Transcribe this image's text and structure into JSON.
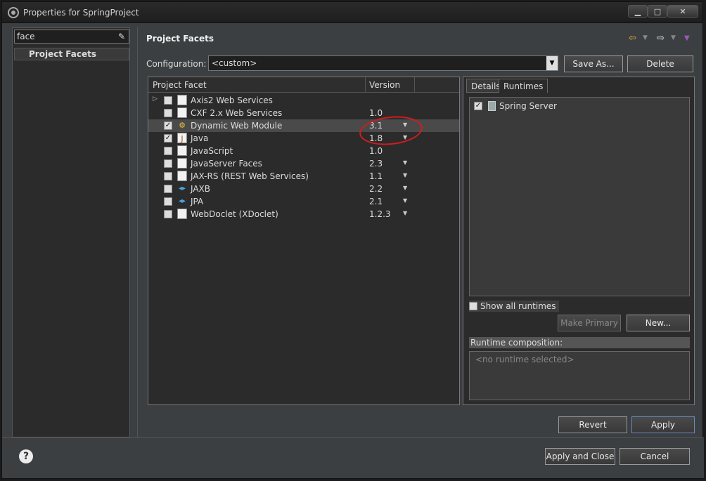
{
  "window": {
    "title": "Properties for SpringProject",
    "minimize": "▁",
    "maximize": "□",
    "close": "✕"
  },
  "sidebar": {
    "filter_value": "face",
    "items": [
      {
        "label": "Project Facets"
      }
    ]
  },
  "header": {
    "title": "Project Facets"
  },
  "configuration": {
    "label": "Configuration:",
    "value": "<custom>",
    "save_as": "Save As...",
    "delete": "Delete"
  },
  "facets": {
    "col_facet": "Project Facet",
    "col_version": "Version",
    "rows": [
      {
        "name": "Axis2 Web Services",
        "version": "",
        "checked": false,
        "expandable": true,
        "icon": "page-icon",
        "dropdown": false
      },
      {
        "name": "CXF 2.x Web Services",
        "version": "1.0",
        "checked": false,
        "icon": "page-icon",
        "dropdown": false
      },
      {
        "name": "Dynamic Web Module",
        "version": "3.1",
        "checked": true,
        "icon": "web-module-icon",
        "dropdown": true,
        "selected": true
      },
      {
        "name": "Java",
        "version": "1.8",
        "checked": true,
        "icon": "java-icon",
        "dropdown": true
      },
      {
        "name": "JavaScript",
        "version": "1.0",
        "checked": false,
        "icon": "page-icon",
        "dropdown": false
      },
      {
        "name": "JavaServer Faces",
        "version": "2.3",
        "checked": false,
        "icon": "page-icon",
        "dropdown": true
      },
      {
        "name": "JAX-RS (REST Web Services)",
        "version": "1.1",
        "checked": false,
        "icon": "page-icon",
        "dropdown": true
      },
      {
        "name": "JAXB",
        "version": "2.2",
        "checked": false,
        "icon": "arrows-icon",
        "dropdown": true
      },
      {
        "name": "JPA",
        "version": "2.1",
        "checked": false,
        "icon": "arrows-icon",
        "dropdown": true
      },
      {
        "name": "WebDoclet (XDoclet)",
        "version": "1.2.3",
        "checked": false,
        "icon": "page-icon",
        "dropdown": true
      }
    ]
  },
  "runtimes": {
    "tab_details": "Details",
    "tab_runtimes": "Runtimes",
    "items": [
      {
        "label": "Spring Server",
        "checked": true
      }
    ],
    "show_all": "Show all runtimes",
    "make_primary": "Make Primary",
    "new": "New...",
    "composition_label": "Runtime composition:",
    "composition_placeholder": "<no runtime selected>"
  },
  "buttons": {
    "revert": "Revert",
    "apply": "Apply",
    "apply_close": "Apply and Close",
    "cancel": "Cancel"
  },
  "colors": {
    "background": "#3c3f41",
    "panel": "#2b2b2b",
    "annotation": "#d21c1c"
  }
}
